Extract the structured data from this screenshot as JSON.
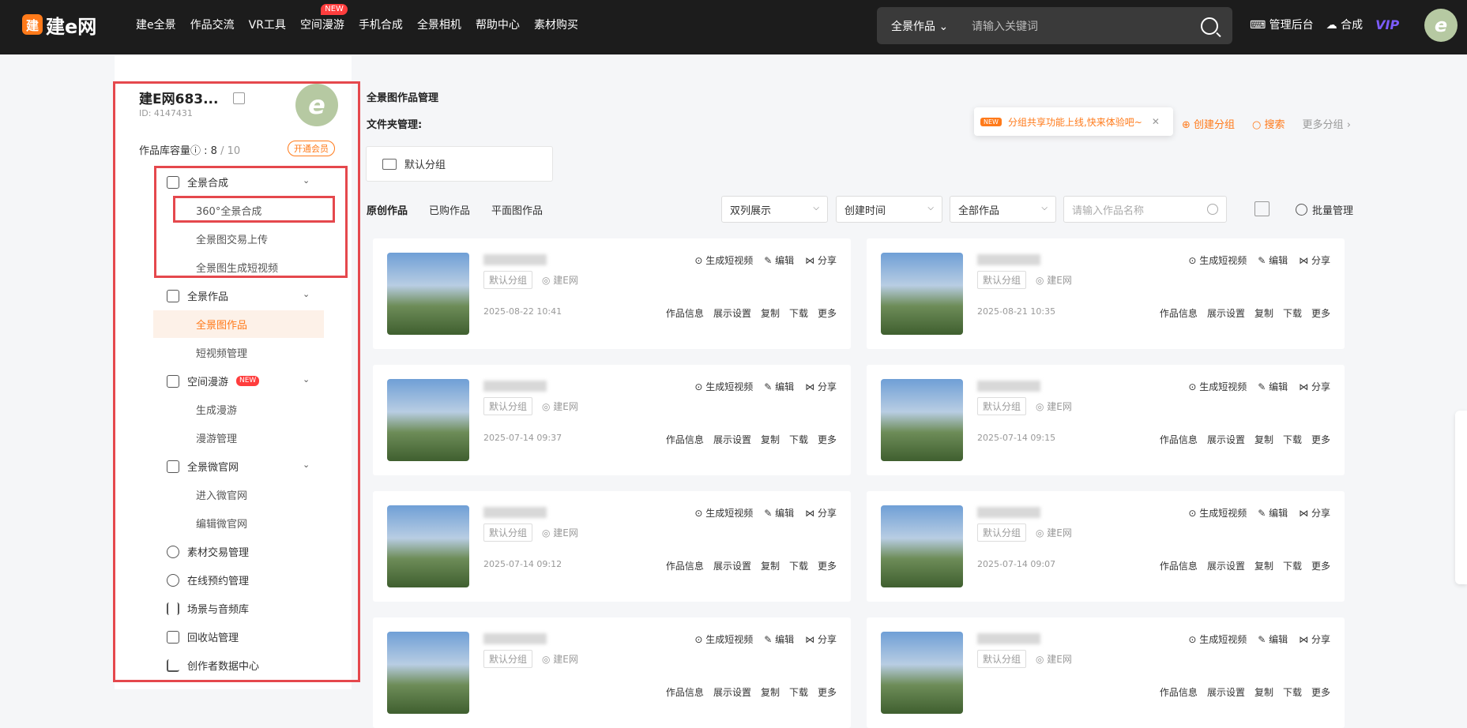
{
  "header": {
    "logo_text": "建e网",
    "nav": [
      "建e全景",
      "作品交流",
      "VR工具",
      "空间漫游",
      "手机合成",
      "全景相机",
      "帮助中心",
      "素材购买"
    ],
    "nav_new": "NEW",
    "search_scope": "全景作品",
    "search_placeholder": "请输入关键词",
    "admin": "管理后台",
    "compose": "合成",
    "vip": "VIP",
    "avatar_letter": "e"
  },
  "sidebar": {
    "username": "建E网683...",
    "uid": "ID: 4147431",
    "capacity_label": "作品库容量",
    "capacity_used": "8",
    "capacity_total": "10",
    "member_btn": "开通会员",
    "groups": [
      {
        "label": "全景合成",
        "items": [
          "360°全景合成",
          "全景图交易上传",
          "全景图生成短视频"
        ]
      },
      {
        "label": "全景作品",
        "items": [
          "全景图作品",
          "短视频管理"
        ]
      },
      {
        "label": "空间漫游",
        "new": "NEW",
        "items": [
          "生成漫游",
          "漫游管理"
        ]
      },
      {
        "label": "全景微官网",
        "items": [
          "进入微官网",
          "编辑微官网"
        ]
      }
    ],
    "singles": [
      "素材交易管理",
      "在线预约管理",
      "场景与音频库",
      "回收站管理",
      "创作者数据中心"
    ]
  },
  "main": {
    "page_title": "全景图作品管理",
    "folder_label": "文件夹管理:",
    "default_folder": "默认分组",
    "tip_badge": "NEW",
    "tip_text": "分组共享功能上线,快来体验吧~",
    "create_group": "创建分组",
    "search": "搜索",
    "more_groups": "更多分组",
    "tabs": [
      "原创作品",
      "已购作品",
      "平面图作品"
    ],
    "filters": [
      "双列展示",
      "创建时间",
      "全部作品"
    ],
    "name_placeholder": "请输入作品名称",
    "batch": "批量管理"
  },
  "card_labels": {
    "gen_video": "生成短视频",
    "edit": "编辑",
    "share": "分享",
    "info": "作品信息",
    "display": "展示设置",
    "copy": "复制",
    "download": "下载",
    "more": "更多",
    "group": "默认分组",
    "source": "建E网"
  },
  "cards": [
    {
      "date": "2025-08-22 10:41"
    },
    {
      "date": "2025-08-21 10:35"
    },
    {
      "date": "2025-07-14 09:37"
    },
    {
      "date": "2025-07-14 09:15"
    },
    {
      "date": "2025-07-14 09:12"
    },
    {
      "date": "2025-07-14 09:07"
    },
    {
      "date": ""
    },
    {
      "date": ""
    }
  ],
  "colors": {
    "accent": "#ff7a1a",
    "highlight": "#e5484d",
    "nav_bg": "#1c1c1c"
  }
}
